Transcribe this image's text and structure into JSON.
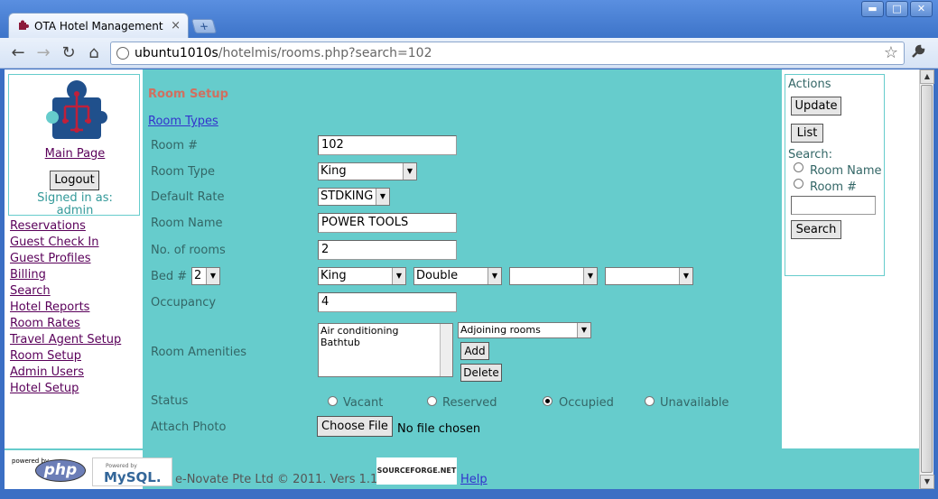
{
  "browser": {
    "tab_title": "OTA Hotel Management",
    "tab_close": "×",
    "new_tab": "+",
    "window_buttons": [
      "▬",
      "□",
      "✕"
    ],
    "url_host": "ubuntu1010s",
    "url_path": "/hotelmis/rooms.php?search=102",
    "nav": {
      "back": "←",
      "forward": "→",
      "reload": "↻",
      "home": "⌂"
    },
    "star": "☆",
    "wrench": "🔧"
  },
  "sidebar": {
    "main_page": "Main Page",
    "logout": "Logout",
    "signed_in_label": "Signed in as:",
    "signed_in_user": "admin",
    "items": [
      "Reservations",
      "Guest Check In",
      "Guest Profiles",
      "Billing",
      "Search",
      "Hotel Reports",
      "Room Rates",
      "Travel Agent Setup",
      "Room Setup",
      "Admin Users",
      "Hotel Setup"
    ]
  },
  "form": {
    "section_title": "Room Setup",
    "room_types_link": "Room Types",
    "labels": {
      "room_no": "Room #",
      "room_type": "Room Type",
      "default_rate": "Default Rate",
      "room_name": "Room Name",
      "no_rooms": "No. of rooms",
      "bed": "Bed #",
      "occupancy": "Occupancy",
      "amenities": "Room Amenities",
      "status": "Status",
      "attach_photo": "Attach Photo"
    },
    "values": {
      "room_no": "102",
      "room_type": "King",
      "default_rate": "STDKING",
      "room_name": "POWER TOOLS",
      "no_rooms": "2",
      "bed_count": "2",
      "bed1": "King",
      "bed2": "Double",
      "bed3": "",
      "bed4": "",
      "occupancy": "4"
    },
    "amenities_list": [
      "Air conditioning",
      "Bathtub"
    ],
    "amenity_dropdown": "Adjoining rooms",
    "add_button": "Add",
    "delete_button": "Delete",
    "status_options": [
      "Vacant",
      "Reserved",
      "Occupied",
      "Unavailable"
    ],
    "status_selected": "Occupied",
    "choose_file": "Choose File",
    "no_file": "No file chosen"
  },
  "actions": {
    "title": "Actions",
    "update": "Update",
    "list": "List",
    "search_label": "Search:",
    "radio_room_name": "Room Name",
    "radio_room_no": "Room #",
    "search_input": "",
    "search_button": "Search"
  },
  "footer": {
    "php_powered": "powered by",
    "php_text": "php",
    "mysql_powered": "Powered by",
    "mysql_text": "MySQL.",
    "copyright": "e-Novate Pte Ltd © 2011. Vers 1.1",
    "sourceforge": "SOURCEFORGE.NET",
    "help": "Help"
  },
  "colors": {
    "page_bg": "#66cccc",
    "link": "#5a005a",
    "label": "#336666",
    "title": "#d07060"
  }
}
